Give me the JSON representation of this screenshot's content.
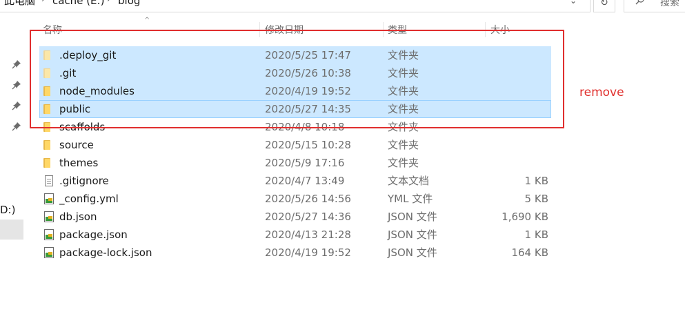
{
  "breadcrumb": {
    "items": [
      "此电脑",
      "cache (E:)",
      "blog"
    ],
    "separator": "›"
  },
  "search": {
    "placeholder": "搜索"
  },
  "columns": {
    "name": "名称",
    "date": "修改日期",
    "type": "类型",
    "size": "大小"
  },
  "navigation": {
    "drive_label": "D:)"
  },
  "files": [
    {
      "name": ".deploy_git",
      "date": "2020/5/25 17:47",
      "type": "文件夹",
      "size": "",
      "icon": "folder-icon",
      "selected": true
    },
    {
      "name": ".git",
      "date": "2020/5/26 10:38",
      "type": "文件夹",
      "size": "",
      "icon": "folder-icon",
      "selected": true
    },
    {
      "name": "node_modules",
      "date": "2020/4/19 19:52",
      "type": "文件夹",
      "size": "",
      "icon": "folder-icon",
      "selected": true
    },
    {
      "name": "public",
      "date": "2020/5/27 14:35",
      "type": "文件夹",
      "size": "",
      "icon": "folder-icon",
      "selected": true
    },
    {
      "name": "scaffolds",
      "date": "2020/4/8 10:18",
      "type": "文件夹",
      "size": "",
      "icon": "folder-icon",
      "selected": false
    },
    {
      "name": "source",
      "date": "2020/5/15 10:28",
      "type": "文件夹",
      "size": "",
      "icon": "folder-icon",
      "selected": false
    },
    {
      "name": "themes",
      "date": "2020/5/9 17:16",
      "type": "文件夹",
      "size": "",
      "icon": "folder-icon",
      "selected": false
    },
    {
      "name": ".gitignore",
      "date": "2020/4/7 13:49",
      "type": "文本文档",
      "size": "1 KB",
      "icon": "text-file-icon",
      "selected": false
    },
    {
      "name": "_config.yml",
      "date": "2020/5/26 14:56",
      "type": "YML 文件",
      "size": "5 KB",
      "icon": "config-file-icon",
      "selected": false
    },
    {
      "name": "db.json",
      "date": "2020/5/27 14:36",
      "type": "JSON 文件",
      "size": "1,690 KB",
      "icon": "config-file-icon",
      "selected": false
    },
    {
      "name": "package.json",
      "date": "2020/4/13 21:28",
      "type": "JSON 文件",
      "size": "1 KB",
      "icon": "config-file-icon",
      "selected": false
    },
    {
      "name": "package-lock.json",
      "date": "2020/4/19 19:52",
      "type": "JSON 文件",
      "size": "164 KB",
      "icon": "config-file-icon",
      "selected": false
    }
  ],
  "annotation": {
    "label": "remove",
    "color": "#e0302e"
  },
  "colors": {
    "selection": "#cce8ff",
    "annotation_border": "#e02e2e"
  }
}
